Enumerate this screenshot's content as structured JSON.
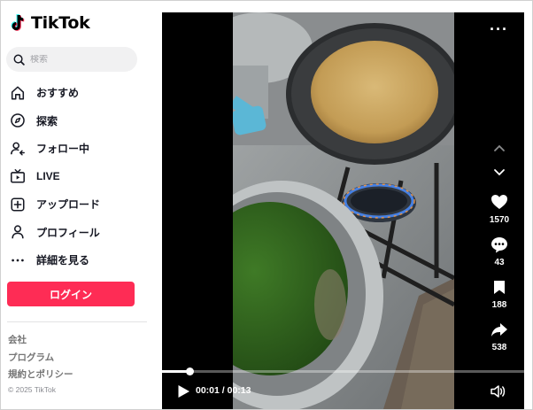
{
  "brand": {
    "name": "TikTok"
  },
  "search": {
    "placeholder": "検索"
  },
  "nav": {
    "items": [
      {
        "label": "おすすめ",
        "icon": "home-icon"
      },
      {
        "label": "探索",
        "icon": "compass-icon"
      },
      {
        "label": "フォロー中",
        "icon": "following-icon"
      },
      {
        "label": "LIVE",
        "icon": "live-tv-icon"
      },
      {
        "label": "アップロード",
        "icon": "upload-icon"
      },
      {
        "label": "プロフィール",
        "icon": "profile-icon"
      },
      {
        "label": "詳細を見る",
        "icon": "more-dots-icon"
      }
    ]
  },
  "login": {
    "label": "ログイン"
  },
  "footer": {
    "links": [
      "会社",
      "プログラム",
      "規約とポリシー"
    ],
    "copyright": "© 2025 TikTok"
  },
  "video": {
    "actions": {
      "likes": "1570",
      "comments": "43",
      "saves": "188",
      "shares": "538"
    },
    "time": {
      "current": "00:01",
      "total": "00:13",
      "display": "00:01 / 00:13"
    },
    "progress": 0.077
  },
  "colors": {
    "accent": "#fe2c55",
    "logo_cyan": "#25f4ee",
    "logo_red": "#fe2c55",
    "background": "#ffffff",
    "video_bg": "#000000"
  }
}
